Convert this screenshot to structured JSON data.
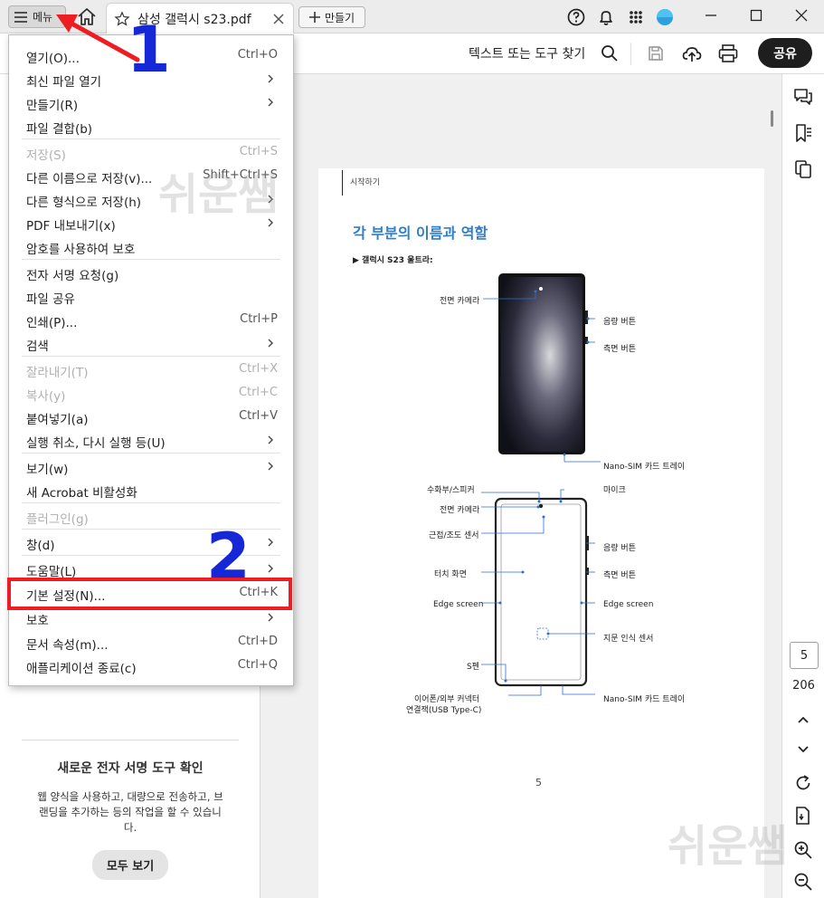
{
  "titlebar": {
    "menu_label": "메뉴",
    "tab_title": "삼성 갤럭시 s23.pdf",
    "create_label": "만들기"
  },
  "toolbar": {
    "find_label": "텍스트 또는 도구 찾기",
    "share_label": "공유"
  },
  "menu": {
    "items": [
      {
        "label": "열기(O)...",
        "shortcut": "Ctrl+O"
      },
      {
        "label": "최신 파일 열기",
        "submenu": true
      },
      {
        "label": "만들기(R)",
        "submenu": true
      },
      {
        "label": "파일 결합(b)"
      },
      {
        "label": "저장(S)",
        "shortcut": "Ctrl+S",
        "disabled": true
      },
      {
        "label": "다른 이름으로 저장(v)...",
        "shortcut": "Shift+Ctrl+S"
      },
      {
        "label": "다른 형식으로 저장(h)",
        "submenu": true
      },
      {
        "label": "PDF 내보내기(x)",
        "submenu": true
      },
      {
        "label": "암호를 사용하여 보호"
      },
      {
        "label": "전자 서명 요청(g)"
      },
      {
        "label": "파일 공유"
      },
      {
        "label": "인쇄(P)...",
        "shortcut": "Ctrl+P"
      },
      {
        "label": "검색",
        "submenu": true
      },
      {
        "label": "잘라내기(T)",
        "shortcut": "Ctrl+X",
        "disabled": true
      },
      {
        "label": "복사(y)",
        "shortcut": "Ctrl+C",
        "disabled": true
      },
      {
        "label": "붙여넣기(a)",
        "shortcut": "Ctrl+V"
      },
      {
        "label": "실행 취소, 다시 실행 등(U)",
        "submenu": true
      },
      {
        "label": "보기(w)",
        "submenu": true
      },
      {
        "label": "새 Acrobat 비활성화"
      },
      {
        "label": "플러그인(g)",
        "disabled": true
      },
      {
        "label": "창(d)",
        "submenu": true
      },
      {
        "label": "도움말(L)",
        "submenu": true
      },
      {
        "label": "기본 설정(N)...",
        "shortcut": "Ctrl+K"
      },
      {
        "label": "보호",
        "submenu": true
      },
      {
        "label": "문서 속성(m)...",
        "shortcut": "Ctrl+D"
      },
      {
        "label": "애플리케이션 종료(c)",
        "shortcut": "Ctrl+Q"
      }
    ]
  },
  "annotations": {
    "step1": "1",
    "step2": "2",
    "watermark": "쉬운쌤"
  },
  "promo": {
    "title": "새로운 전자 서명 도구 확인",
    "body": "웹 양식을 사용하고, 대량으로 전송하고, 브랜딩을 추가하는 등의 작업을 할 수 있습니다.",
    "button": "모두 보기"
  },
  "document": {
    "section": "시작하기",
    "heading": "각 부분의 이름과 역할",
    "subheading": "▶ 갤럭시 S23 울트라:",
    "labels": {
      "front_camera": "전면 카메라",
      "volume": "음량 버튼",
      "side": "측면 버튼",
      "sim": "Nano-SIM 카드 트레이",
      "receiver": "수화부/스피커",
      "mic": "마이크",
      "front_camera2": "전면 카메라",
      "proximity": "근접/조도 센서",
      "volume2": "음량 버튼",
      "touch": "터치 화면",
      "side2": "측면 버튼",
      "edge_left": "Edge screen",
      "edge_right": "Edge screen",
      "fingerprint": "지문 인식 센서",
      "spen": "S펜",
      "connector": "이어폰/외부 커넥터",
      "connector2": "연결잭(USB Type-C)",
      "sim2": "Nano-SIM 카드 트레이"
    },
    "page_number": "5"
  },
  "navigation": {
    "current_page": "5",
    "total_pages": "206"
  }
}
